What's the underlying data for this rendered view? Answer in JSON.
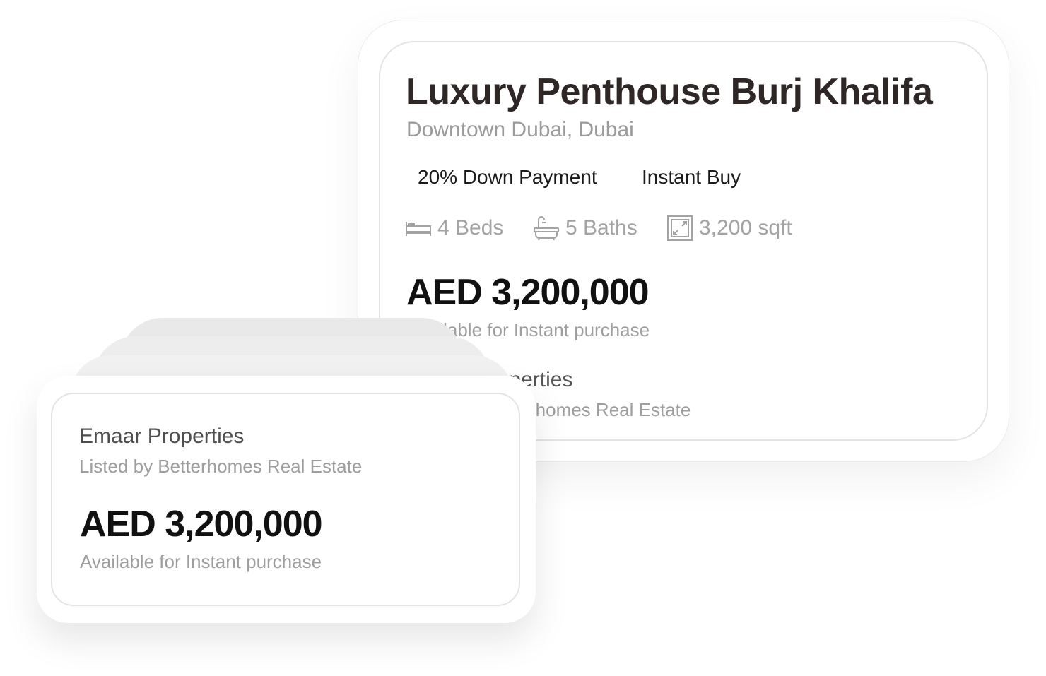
{
  "detail_card": {
    "title": "Luxury Penthouse Burj Khalifa",
    "location": "Downtown Dubai, Dubai",
    "tags": [
      "20% Down Payment",
      "Instant Buy"
    ],
    "features": {
      "beds": {
        "icon": "bed-icon",
        "label": "4 Beds"
      },
      "baths": {
        "icon": "bathtub-icon",
        "label": "5 Baths"
      },
      "area": {
        "icon": "expand-area-icon",
        "label": "3,200 sqft"
      }
    },
    "price": "AED 3,200,000",
    "availability": "Available for Instant purchase",
    "developer": "Emaar Properties",
    "lister": "Listed by Betterhomes Real Estate"
  },
  "front_card": {
    "developer": "Emaar Properties",
    "lister": "Listed by Betterhomes Real Estate",
    "price": "AED 3,200,000",
    "availability": "Available for Instant purchase"
  },
  "colors": {
    "title": "#2f2626",
    "muted_text": "#9e9e9e",
    "price": "#111111",
    "card_border": "#e4e4e4",
    "stack_layer": "#ebebeb"
  }
}
